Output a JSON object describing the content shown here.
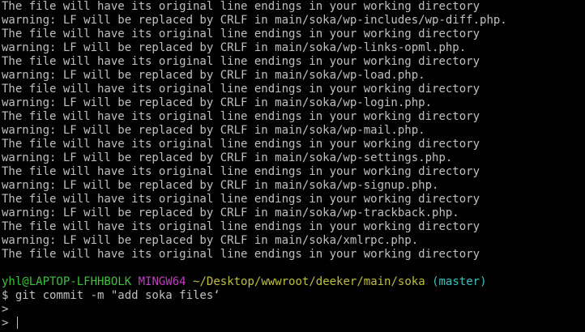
{
  "output_lines": [
    "The file will have its original line endings in your working directory",
    "warning: LF will be replaced by CRLF in main/soka/wp-includes/wp-diff.php.",
    "The file will have its original line endings in your working directory",
    "warning: LF will be replaced by CRLF in main/soka/wp-links-opml.php.",
    "The file will have its original line endings in your working directory",
    "warning: LF will be replaced by CRLF in main/soka/wp-load.php.",
    "The file will have its original line endings in your working directory",
    "warning: LF will be replaced by CRLF in main/soka/wp-login.php.",
    "The file will have its original line endings in your working directory",
    "warning: LF will be replaced by CRLF in main/soka/wp-mail.php.",
    "The file will have its original line endings in your working directory",
    "warning: LF will be replaced by CRLF in main/soka/wp-settings.php.",
    "The file will have its original line endings in your working directory",
    "warning: LF will be replaced by CRLF in main/soka/wp-signup.php.",
    "The file will have its original line endings in your working directory",
    "warning: LF will be replaced by CRLF in main/soka/wp-trackback.php.",
    "The file will have its original line endings in your working directory",
    "warning: LF will be replaced by CRLF in main/soka/xmlrpc.php.",
    "The file will have its original line endings in your working directory"
  ],
  "prompt": {
    "user_host": "yhl@LAPTOP-LFHHBOLK",
    "shell": "MINGW64",
    "path": "~/Desktop/wwwroot/deeker/main/soka",
    "branch": "(master)"
  },
  "command": "$ git commit -m \"add soka files‘",
  "continuation_1": ">",
  "continuation_2": "> ",
  "colors": {
    "background": "#000000",
    "text": "#c0c0c0",
    "user_host": "#3fbf3f",
    "shell": "#bf3fbf",
    "path": "#bfbf3f",
    "branch": "#3fbfbf"
  }
}
